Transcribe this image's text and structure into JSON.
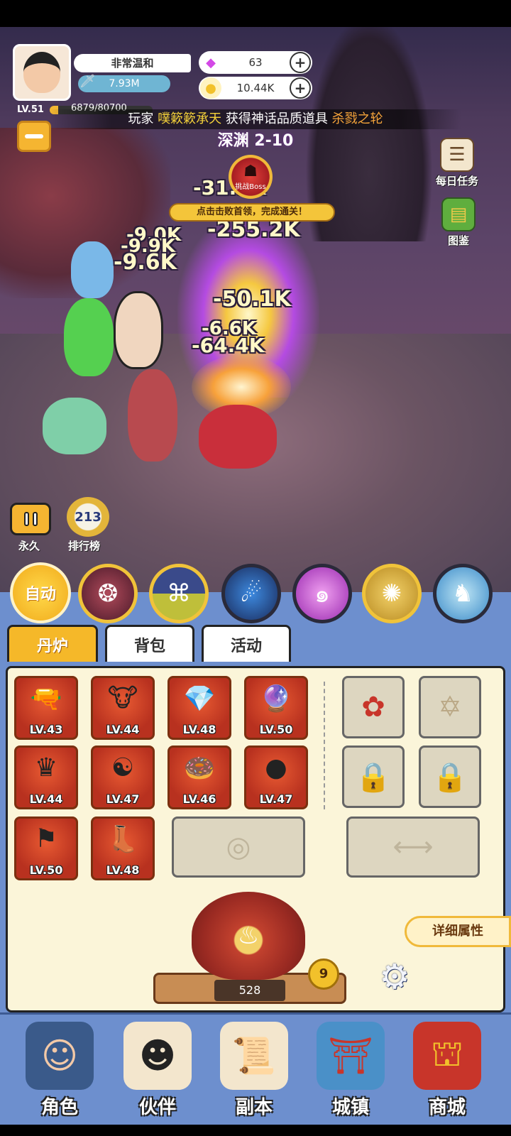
{
  "player": {
    "name": "非常温和",
    "power": "7.93M",
    "level": "LV.51",
    "exp": "6879/80700",
    "exp_fraction": 0.085
  },
  "currency": {
    "gems": "63",
    "gold": "10.44K"
  },
  "broadcast": {
    "prefix": "玩家",
    "player": "噗簌簌承天",
    "middle": "获得神话品质道具",
    "item": "杀戮之轮"
  },
  "stage": {
    "name": "深渊 2-10",
    "boss_label": "挑战Boss",
    "hint": "点击击败首领，完成通关！"
  },
  "damage_numbers": [
    "-31.5K",
    "-255.2K",
    "-9.0K",
    "-9.9K",
    "-9.6K",
    "-50.1K",
    "-6.6K",
    "-64.4K"
  ],
  "side_buttons": {
    "daily_tasks": "每日任务",
    "codex": "图鉴"
  },
  "controls": {
    "pause_label": "永久",
    "rank_label": "排行榜",
    "rank_icon_text": "213",
    "auto_label": "自动"
  },
  "skills": [
    {
      "icon": "beast-icon"
    },
    {
      "icon": "rune-icon"
    },
    {
      "icon": "comet-icon"
    },
    {
      "icon": "vortex-icon"
    },
    {
      "icon": "sun-icon"
    },
    {
      "icon": "unicorn-icon"
    }
  ],
  "tabs": [
    "丹炉",
    "背包",
    "活动"
  ],
  "inventory": {
    "items": [
      {
        "icon": "gun-icon",
        "level": "LV.43"
      },
      {
        "icon": "beast-skull-icon",
        "level": "LV.44"
      },
      {
        "icon": "crystal-icon",
        "level": "LV.48"
      },
      {
        "icon": "orb-icon",
        "level": "LV.50"
      },
      {
        "icon": "crown-icon",
        "level": "LV.44"
      },
      {
        "icon": "bagua-icon",
        "level": "LV.47"
      },
      {
        "icon": "donut-icon",
        "level": "LV.46"
      },
      {
        "icon": "pearl-icon",
        "level": "LV.47"
      },
      {
        "icon": "flag-icon",
        "level": "LV.50"
      },
      {
        "icon": "boots-icon",
        "level": "LV.48"
      }
    ],
    "equip_slots": [
      "flower-icon",
      "hexagram-icon",
      "lock-icon",
      "lock-icon"
    ]
  },
  "detail_label": "详细属性",
  "furnace": {
    "count": "528",
    "level": "9"
  },
  "bottom_nav": [
    "角色",
    "伙伴",
    "副本",
    "城镇",
    "商城"
  ]
}
